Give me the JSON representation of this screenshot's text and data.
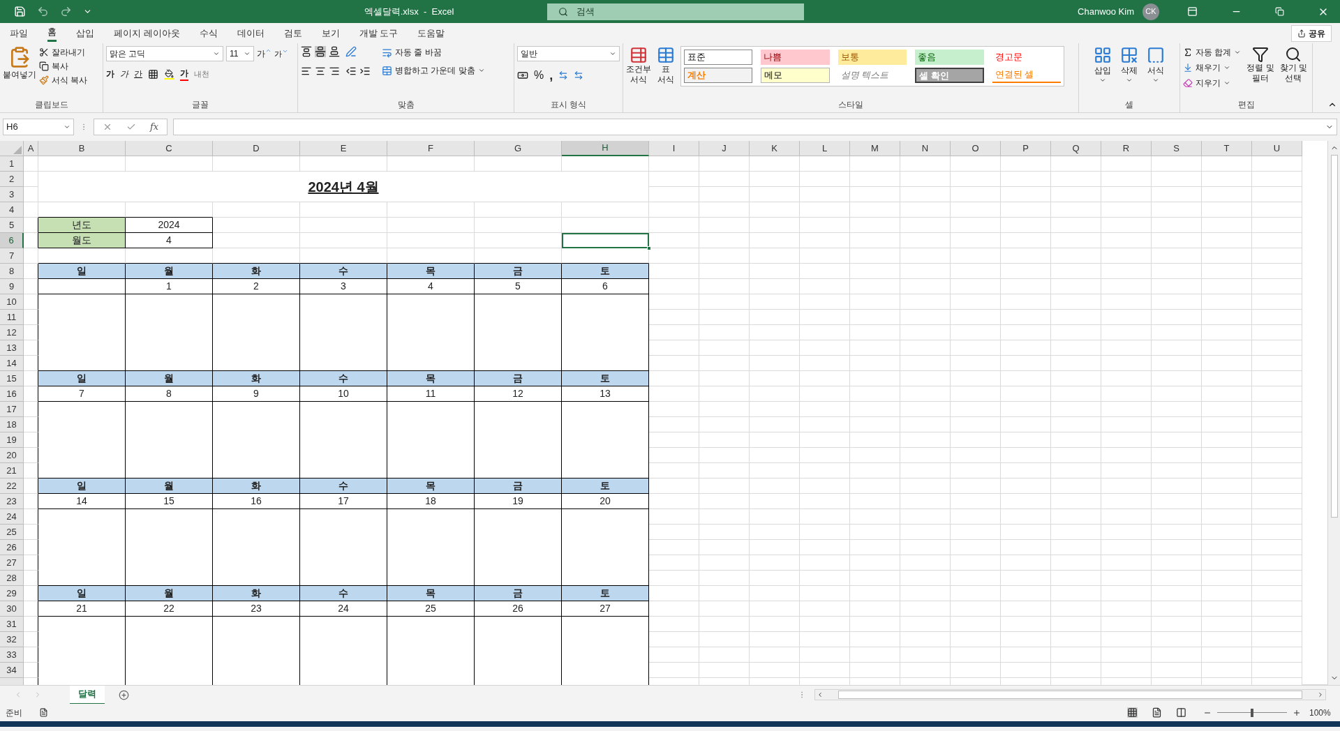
{
  "title_bar": {
    "file_title": "엑셀달력.xlsx  -  Excel",
    "search": {
      "placeholder": "검색"
    },
    "user": "Chanwoo Kim",
    "avatar": "CK"
  },
  "menu_tabs": [
    {
      "label": "파일",
      "selected": false
    },
    {
      "label": "홈",
      "selected": true
    },
    {
      "label": "삽입",
      "selected": false
    },
    {
      "label": "페이지 레이아웃",
      "selected": false
    },
    {
      "label": "수식",
      "selected": false
    },
    {
      "label": "데이터",
      "selected": false
    },
    {
      "label": "검토",
      "selected": false
    },
    {
      "label": "보기",
      "selected": false
    },
    {
      "label": "개발 도구",
      "selected": false
    },
    {
      "label": "도움말",
      "selected": false
    }
  ],
  "share_button": "공유",
  "ribbon": {
    "clipboard": {
      "paste": "붙여넣기",
      "cut": "잘라내기",
      "copy": "복사",
      "format_painter": "서식 복사",
      "label": "클립보드"
    },
    "font": {
      "font_name": "맑은 고딕",
      "font_size": "11",
      "grow": "가",
      "shrink": "가",
      "bold": "가",
      "italic": "가",
      "underline": "간",
      "font_color": "가",
      "phonetic": "내천",
      "label": "글꼴"
    },
    "alignment": {
      "wrap_text": "자동 줄 바꿈",
      "merge_center": "병합하고 가운데 맞춤",
      "label": "맞춤"
    },
    "number": {
      "format": "일반",
      "percent": "%",
      "comma": ",",
      "label": "표시 형식"
    },
    "styles": {
      "conditional": [
        "조건부",
        "서식"
      ],
      "table": [
        "표",
        "서식"
      ],
      "label": "스타일",
      "gallery": [
        {
          "label": "표준",
          "color": "#ffffff",
          "kind": "normal"
        },
        {
          "label": "나쁨",
          "color": "#ffc7ce",
          "kind": "bad"
        },
        {
          "label": "보통",
          "color": "#ffeb9c",
          "kind": "neutral"
        },
        {
          "label": "좋음",
          "color": "#c6efce",
          "kind": "good"
        },
        {
          "label": "경고문",
          "color": "#ffffff",
          "kind": "warning"
        },
        {
          "label": "계산",
          "color": "#f2f2f2",
          "kind": "calc"
        },
        {
          "label": "메모",
          "color": "#ffffcc",
          "kind": "note"
        },
        {
          "label": "설명 텍스트",
          "color": "#ffffff",
          "kind": "explanatory"
        },
        {
          "label": "셀 확인",
          "color": "#a5a5a5",
          "kind": "check"
        },
        {
          "label": "연결된 셀",
          "color": "#ffffff",
          "kind": "linked"
        }
      ]
    },
    "cells": {
      "buttons": [
        "삽입",
        "삭제",
        "서식"
      ],
      "label": "셀"
    },
    "editing": {
      "autosum": "자동 합계",
      "fill": "채우기",
      "clear": "지우기",
      "sort_filter": [
        "정렬 및",
        "필터"
      ],
      "find_select": [
        "찾기 및",
        "선택"
      ],
      "label": "편집"
    }
  },
  "formula_bar": {
    "name_box": "H6",
    "fx": "fx"
  },
  "columns": [
    {
      "label": "A",
      "selected": false
    },
    {
      "label": "B",
      "selected": false
    },
    {
      "label": "C",
      "selected": false
    },
    {
      "label": "D",
      "selected": false
    },
    {
      "label": "E",
      "selected": false
    },
    {
      "label": "F",
      "selected": false
    },
    {
      "label": "G",
      "selected": false
    },
    {
      "label": "H",
      "selected": true
    },
    {
      "label": "I",
      "selected": false
    },
    {
      "label": "J",
      "selected": false
    },
    {
      "label": "K",
      "selected": false
    },
    {
      "label": "L",
      "selected": false
    },
    {
      "label": "M",
      "selected": false
    },
    {
      "label": "N",
      "selected": false
    },
    {
      "label": "O",
      "selected": false
    },
    {
      "label": "P",
      "selected": false
    },
    {
      "label": "Q",
      "selected": false
    },
    {
      "label": "R",
      "selected": false
    },
    {
      "label": "S",
      "selected": false
    },
    {
      "label": "T",
      "selected": false
    },
    {
      "label": "U",
      "selected": false
    }
  ],
  "row_headers": [
    {
      "label": "1",
      "selected": false
    },
    {
      "label": "2",
      "selected": false
    },
    {
      "label": "3",
      "selected": false
    },
    {
      "label": "4",
      "selected": false
    },
    {
      "label": "5",
      "selected": false
    },
    {
      "label": "6",
      "selected": true
    },
    {
      "label": "7",
      "selected": false
    },
    {
      "label": "8",
      "selected": false
    },
    {
      "label": "9",
      "selected": false
    },
    {
      "label": "10",
      "selected": false
    },
    {
      "label": "11",
      "selected": false
    },
    {
      "label": "12",
      "selected": false
    },
    {
      "label": "13",
      "selected": false
    },
    {
      "label": "14",
      "selected": false
    },
    {
      "label": "15",
      "selected": false
    },
    {
      "label": "16",
      "selected": false
    },
    {
      "label": "17",
      "selected": false
    },
    {
      "label": "18",
      "selected": false
    },
    {
      "label": "19",
      "selected": false
    },
    {
      "label": "20",
      "selected": false
    },
    {
      "label": "21",
      "selected": false
    },
    {
      "label": "22",
      "selected": false
    },
    {
      "label": "23",
      "selected": false
    },
    {
      "label": "24",
      "selected": false
    },
    {
      "label": "25",
      "selected": false
    },
    {
      "label": "26",
      "selected": false
    },
    {
      "label": "27",
      "selected": false
    },
    {
      "label": "28",
      "selected": false
    },
    {
      "label": "29",
      "selected": false
    },
    {
      "label": "30",
      "selected": false
    },
    {
      "label": "31",
      "selected": false
    },
    {
      "label": "32",
      "selected": false
    },
    {
      "label": "33",
      "selected": false
    },
    {
      "label": "34",
      "selected": false
    }
  ],
  "sheet": {
    "title": "2024년 4월",
    "year_label": "년도",
    "year": "2024",
    "month_label": "월도",
    "month": "4",
    "weeks": [
      {
        "days": [
          "일",
          "월",
          "화",
          "수",
          "목",
          "금",
          "토"
        ],
        "dates": [
          "1",
          "2",
          "3",
          "4",
          "5",
          "6"
        ]
      },
      {
        "days": [
          "일",
          "월",
          "화",
          "수",
          "목",
          "금",
          "토"
        ],
        "dates": [
          "7",
          "8",
          "9",
          "10",
          "11",
          "12",
          "13"
        ]
      },
      {
        "days": [
          "일",
          "월",
          "화",
          "수",
          "목",
          "금",
          "토"
        ],
        "dates": [
          "14",
          "15",
          "16",
          "17",
          "18",
          "19",
          "20"
        ]
      },
      {
        "days": [
          "일",
          "월",
          "화",
          "수",
          "목",
          "금",
          "토"
        ],
        "dates": [
          "21",
          "22",
          "23",
          "24",
          "25",
          "26",
          "27"
        ]
      }
    ]
  },
  "sheet_tabs": [
    {
      "label": "달력",
      "selected": true
    }
  ],
  "status_bar": {
    "status": "준비",
    "zoom": "100%",
    "level": 0.5
  }
}
